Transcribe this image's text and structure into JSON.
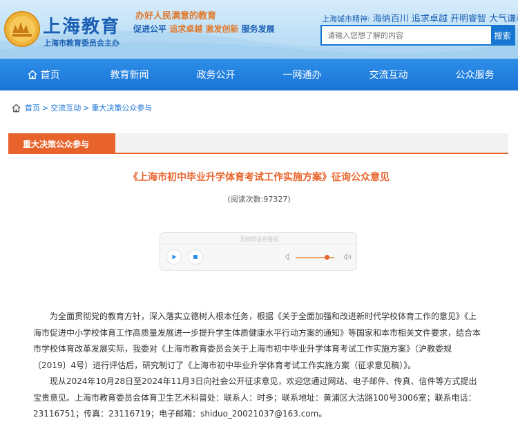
{
  "header": {
    "logo_title": "上海教育",
    "logo_subtitle": "上海市教育委员会主办",
    "slogan_line1": "办好人民满意的教育",
    "slogan_line2_a": "促进公平",
    "slogan_line2_b": "追求卓越",
    "slogan_line2_c": "激发创新",
    "slogan_line2_d": "服务发展",
    "city_spirit_label": "上海城市精神:",
    "city_spirit_text": "海纳百川 追求卓越 开明睿智 大气谦和",
    "search": {
      "placeholder": "请输入您想了解的内容",
      "button_label": "搜索"
    }
  },
  "nav": {
    "items": [
      {
        "label": "首页"
      },
      {
        "label": "教育新闻"
      },
      {
        "label": "政务公开"
      },
      {
        "label": "一网通办"
      },
      {
        "label": "交流互动"
      },
      {
        "label": "公众服务"
      }
    ]
  },
  "breadcrumb": {
    "items": [
      "首页",
      "交流互动",
      "重大决策公众参与"
    ],
    "separator": ">"
  },
  "section": {
    "tab_label": "重大决策公众参与"
  },
  "article": {
    "title": "《上海市初中毕业升学体育考试工作实施方案》征询公众意见",
    "read_count_label": "(阅读次数:97327)",
    "player": {
      "title": "无障碍语音播报",
      "volume": 0.82
    },
    "paragraph1": "为全面贯彻党的教育方针，深入落实立德树人根本任务，根据《关于全面加强和改进新时代学校体育工作的意见》《上海市促进中小学校体育工作高质量发展进一步提升学生体质健康水平行动方案的通知》等国家和本市相关文件要求，结合本市学校体育改革发展实际，我委对《上海市教育委员会关于上海市初中毕业升学体育考试工作实施方案》（沪教委规〔2019〕4号）进行评估后，研究制订了《上海市初中毕业升学体育考试工作实施方案（征求意见稿）》。",
    "paragraph2": "现从2024年10月28日至2024年11月3日向社会公开征求意见，欢迎您通过网站、电子邮件、传真、信件等方式提出宝贵意见。上海市教育委员会体育卫生艺术科普处：联系人：时多；联系地址：黄浦区大沽路100号3006室；联系电话：23116751；传真：23116719；电子邮箱：shiduo_20021037@163.com。"
  },
  "colors": {
    "brand_blue": "#1a74d6",
    "accent_orange": "#e8632b"
  }
}
